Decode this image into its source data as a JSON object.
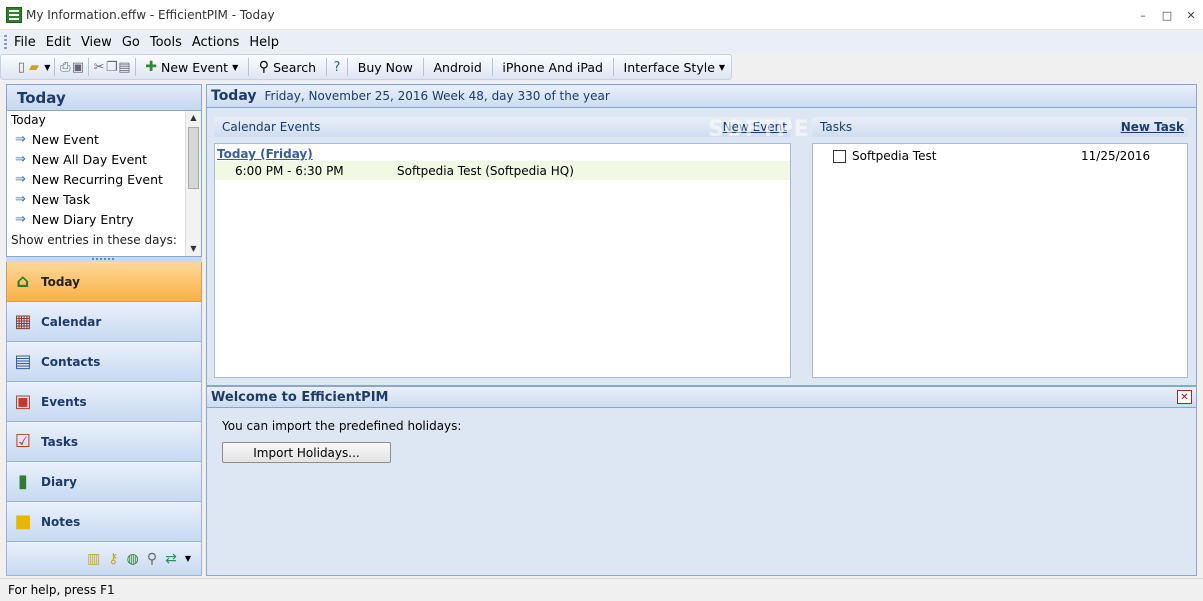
{
  "window": {
    "title": "My Information.effw - EfficientPIM - Today",
    "minimize": "–",
    "maximize": "□",
    "close": "✕"
  },
  "menu": [
    "File",
    "Edit",
    "View",
    "Go",
    "Tools",
    "Actions",
    "Help"
  ],
  "toolbar": {
    "new_event": "New Event",
    "search": "Search",
    "buy_now": "Buy Now",
    "android": "Android",
    "iphone": "iPhone And iPad",
    "interface_style": "Interface Style"
  },
  "left": {
    "header": "Today",
    "sub": "Today",
    "actions": [
      "New Event",
      "New All Day Event",
      "New Recurring Event",
      "New Task",
      "New Diary Entry"
    ],
    "more": "Show entries in these days:",
    "nav": [
      "Today",
      "Calendar",
      "Contacts",
      "Events",
      "Tasks",
      "Diary",
      "Notes"
    ]
  },
  "main": {
    "title": "Today",
    "date": "Friday, November 25, 2016  Week 48, day 330 of the year",
    "calendar_head": "Calendar  Events",
    "new_event_link": "New Event",
    "day_label": "Today (Friday)",
    "event_time": "6:00 PM - 6:30 PM",
    "event_title": "Softpedia Test (Softpedia  HQ)",
    "tasks_head": "Tasks",
    "new_task_link": "New Task",
    "task_name": "Softpedia Test",
    "task_date": "11/25/2016",
    "welcome_title": "Welcome to EfficientPIM",
    "welcome_text": "You can import the predefined holidays:",
    "import_button": "Import Holidays..."
  },
  "status": "For help, press F1",
  "watermark": "SOFTPEDIA"
}
